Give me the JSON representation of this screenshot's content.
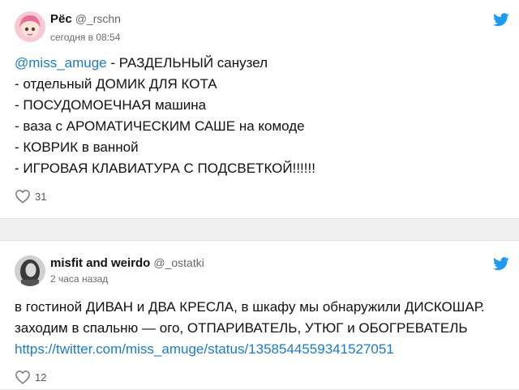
{
  "colors": {
    "accent": "#1d9bf0",
    "link": "#1b7bc4",
    "muted": "#666666"
  },
  "tweets": [
    {
      "name": "Рёс",
      "handle": "@_rschn",
      "time": "сегодня в 08:54",
      "mention": "@miss_amuge",
      "text": " - РАЗДЕЛЬНЫЙ санузел\n- отдельный ДОМИК ДЛЯ КОТА\n- ПОСУДОМОЕЧНАЯ машина\n- ваза с АРОМАТИЧЕСКИМ САШЕ на комоде\n- КОВРИК в ванной\n- ИГРОВАЯ КЛАВИАТУРА С ПОДСВЕТКОЙ!!!!!!",
      "likes": "31",
      "icons": {
        "avatar": "avatar-illustration",
        "brand": "twitter-bird-icon",
        "like": "heart-icon"
      }
    },
    {
      "name": "misfit and weirdo",
      "handle": "@_ostatki",
      "time": "2 часа назад",
      "text": "в гостиной ДИВАН и ДВА КРЕСЛА, в шкафу мы обнаружили ДИСКОШАР.\nзаходим в спальню — ого, ОТПАРИВАТЕЛЬ, УТЮГ и ОБОГРЕВАТЕЛЬ",
      "link": "https://twitter.com/miss_amuge/status/1358544559341527051",
      "likes": "12",
      "icons": {
        "avatar": "avatar-photo",
        "brand": "twitter-bird-icon",
        "like": "heart-icon"
      }
    }
  ]
}
